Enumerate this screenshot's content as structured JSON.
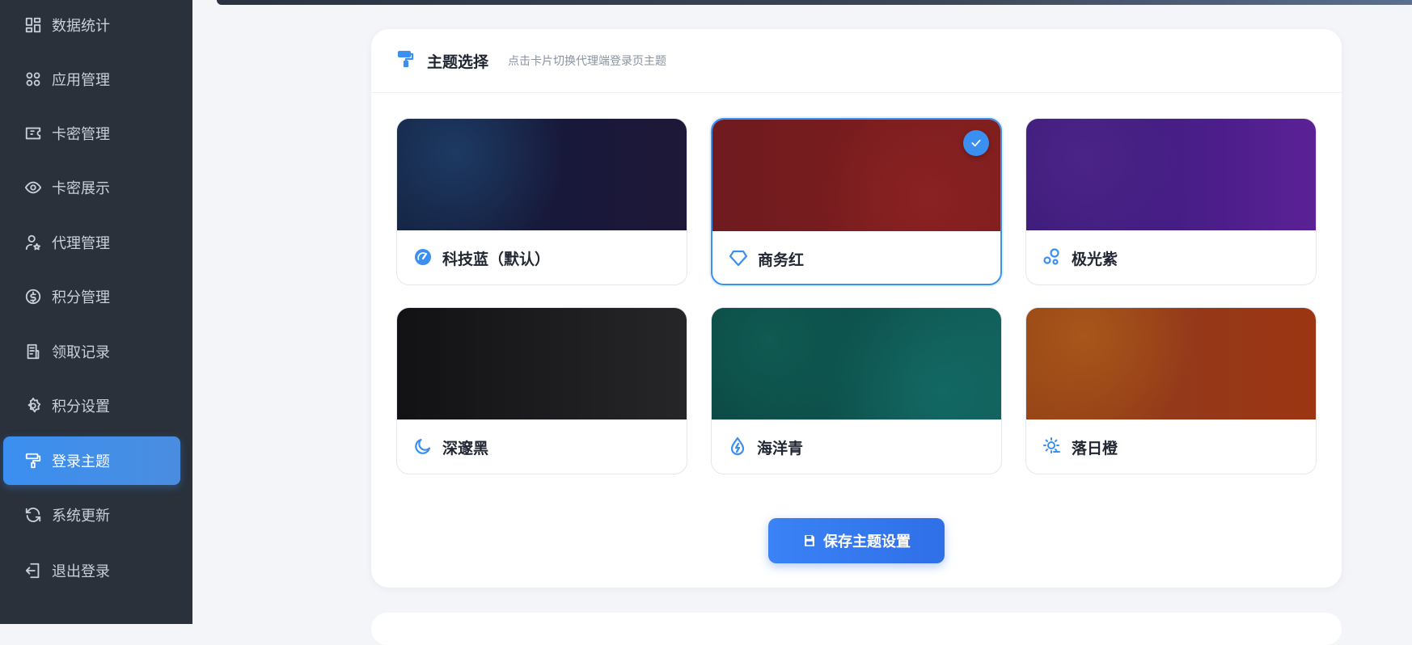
{
  "sidebar": {
    "items": [
      {
        "label": "数据统计",
        "icon": "dashboard-icon"
      },
      {
        "label": "应用管理",
        "icon": "apps-icon"
      },
      {
        "label": "卡密管理",
        "icon": "ticket-icon"
      },
      {
        "label": "卡密展示",
        "icon": "eye-icon"
      },
      {
        "label": "代理管理",
        "icon": "user-star-icon"
      },
      {
        "label": "积分管理",
        "icon": "coin-icon"
      },
      {
        "label": "领取记录",
        "icon": "receipt-icon"
      },
      {
        "label": "积分设置",
        "icon": "gear-icon"
      },
      {
        "label": "登录主题",
        "icon": "paint-roller-icon",
        "active": true
      },
      {
        "label": "系统更新",
        "icon": "refresh-icon"
      },
      {
        "label": "退出登录",
        "icon": "logout-icon"
      }
    ]
  },
  "panel": {
    "title": "主题选择",
    "subtitle": "点击卡片切换代理端登录页主题",
    "header_icon": "paint-roller-icon"
  },
  "themes": [
    {
      "label": "科技蓝（默认）",
      "icon": "gauge-icon",
      "color_from": "#162a4a",
      "color_to": "#1d1a3a",
      "selected": false
    },
    {
      "label": "商务红",
      "icon": "diamond-icon",
      "color_from": "#6f1b1f",
      "color_to": "#7f1d1d",
      "selected": true
    },
    {
      "label": "极光紫",
      "icon": "bubbles-icon",
      "color_from": "#3f1d7a",
      "color_to": "#5b2196",
      "selected": false
    },
    {
      "label": "深邃黑",
      "icon": "moon-icon",
      "color_from": "#131316",
      "color_to": "#262628",
      "selected": false
    },
    {
      "label": "海洋青",
      "icon": "drop-bolt-icon",
      "color_from": "#0d4a45",
      "color_to": "#115e5a",
      "selected": false
    },
    {
      "label": "落日橙",
      "icon": "sun-cloud-icon",
      "color_from": "#9a4a12",
      "color_to": "#9c3512",
      "selected": false
    }
  ],
  "save_button": {
    "label": "保存主题设置",
    "icon": "save-icon"
  },
  "colors": {
    "accent": "#3b8ff0",
    "sidebar_bg": "#2a313b"
  }
}
